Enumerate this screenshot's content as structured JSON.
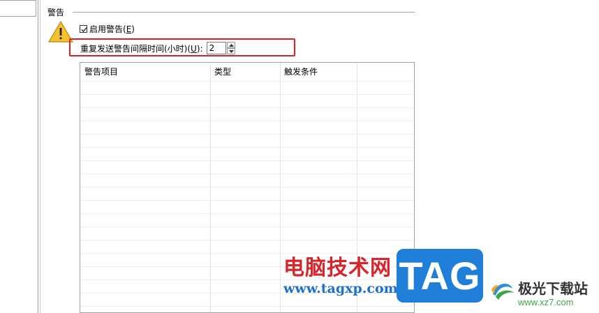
{
  "group": {
    "title": "警告"
  },
  "enable_alert": {
    "label": "启用警告(",
    "accel": "E",
    "suffix": ")",
    "checked": true
  },
  "interval": {
    "label": "重复发送警告间隔时间(小时)(",
    "accel": "U",
    "suffix": "):",
    "value": "2"
  },
  "table": {
    "columns": [
      "警告项目",
      "类型",
      "触发条件",
      ""
    ],
    "rows": []
  },
  "watermarks": {
    "site_cn": "电脑技术网",
    "site_url": "www.tagxp.com",
    "tag_logo": "TAG",
    "xz_cn": "极光下载站",
    "xz_url": "www.xz7.com"
  },
  "colors": {
    "highlight": "#e02020",
    "warning_icon": "#f5c12e",
    "tag_logo_bg": "#1f7ed8"
  },
  "icons": {
    "warning": "warning-triangle-icon",
    "checkbox": "checkmark-icon",
    "spin_up": "chevron-up-icon",
    "spin_down": "chevron-down-icon"
  }
}
